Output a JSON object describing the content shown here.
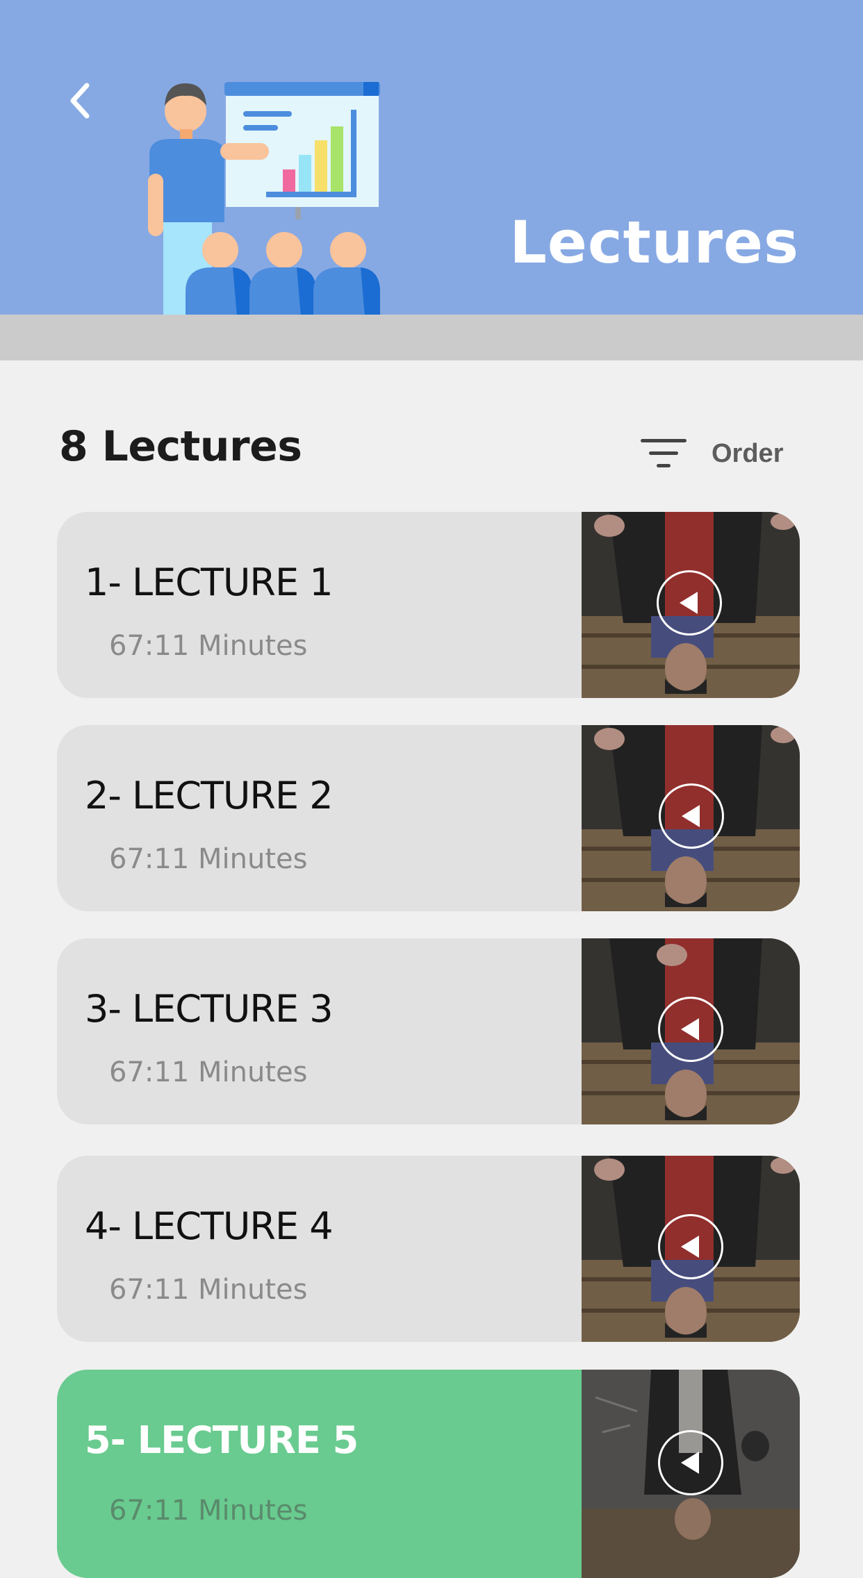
{
  "header": {
    "title": "Lectures",
    "back_icon": "chevron-left-icon",
    "background": "#87a9e3"
  },
  "list_header": {
    "count_title": "8 Lectures",
    "order_label": "Order",
    "order_icon": "filter-icon"
  },
  "lectures": [
    {
      "title": "1- LECTURE 1",
      "duration": "67:11 Minutes",
      "active": false
    },
    {
      "title": "2- LECTURE 2",
      "duration": "67:11 Minutes",
      "active": false
    },
    {
      "title": "3- LECTURE 3",
      "duration": "67:11 Minutes",
      "active": false
    },
    {
      "title": "4- LECTURE 4",
      "duration": "67:11 Minutes",
      "active": false
    },
    {
      "title": "5- LECTURE 5",
      "duration": "67:11 Minutes",
      "active": true
    }
  ],
  "colors": {
    "card": "#e1e1e1",
    "active_card": "#69cb8f",
    "page_bg": "#f0f0f0"
  }
}
